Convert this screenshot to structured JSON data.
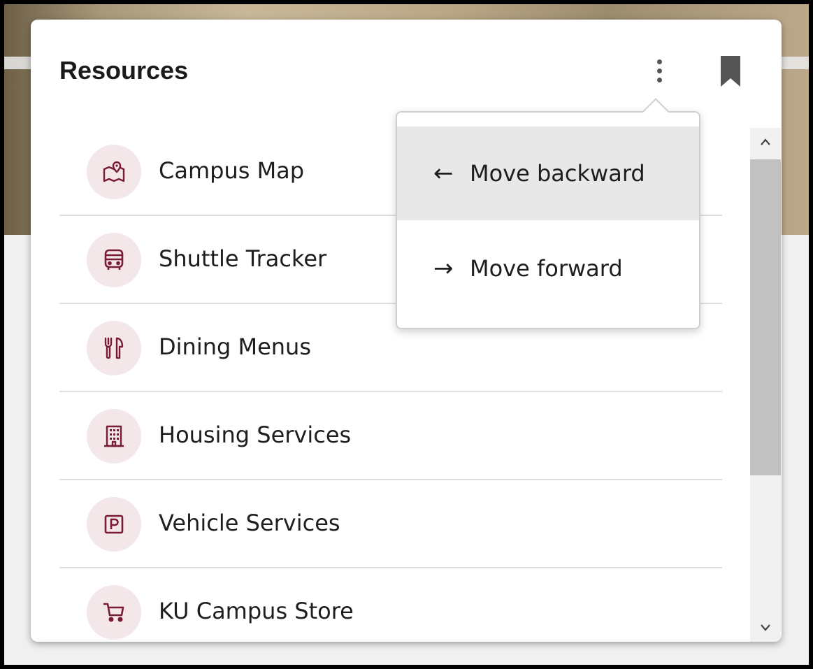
{
  "panel": {
    "title": "Resources",
    "options_icon": "more-vertical-icon",
    "bookmark_icon": "bookmark-icon"
  },
  "resources": [
    {
      "label": "Campus Map",
      "icon": "map-pin-icon"
    },
    {
      "label": "Shuttle Tracker",
      "icon": "bus-icon"
    },
    {
      "label": "Dining Menus",
      "icon": "utensils-icon"
    },
    {
      "label": "Housing Services",
      "icon": "building-icon"
    },
    {
      "label": "Vehicle Services",
      "icon": "parking-icon"
    },
    {
      "label": "KU Campus Store",
      "icon": "cart-icon"
    }
  ],
  "menu": {
    "items": [
      {
        "label": "Move backward",
        "icon": "arrow-left-icon",
        "glyph": "←",
        "highlighted": true
      },
      {
        "label": "Move forward",
        "icon": "arrow-right-icon",
        "glyph": "→",
        "highlighted": false
      }
    ]
  },
  "colors": {
    "accent": "#7a1d34",
    "icon_bg": "#f3e7ea",
    "menu_highlight": "#e8e8e8"
  }
}
